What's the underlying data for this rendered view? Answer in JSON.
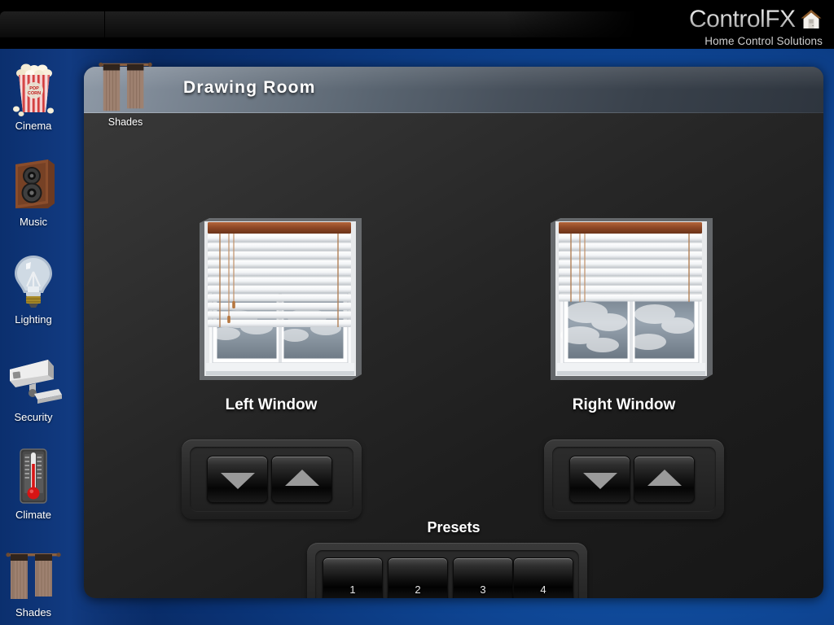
{
  "brand": {
    "name": "ControlFX",
    "tagline": "Home Control Solutions",
    "house_icon": "house-icon",
    "accent_blue": "#1358ae",
    "panel_dark": "#262626"
  },
  "sidebar": {
    "items": [
      {
        "label": "Cinema",
        "icon": "popcorn-icon"
      },
      {
        "label": "Music",
        "icon": "speaker-icon"
      },
      {
        "label": "Lighting",
        "icon": "lightbulb-icon"
      },
      {
        "label": "Security",
        "icon": "security-camera-icon"
      },
      {
        "label": "Climate",
        "icon": "thermometer-icon"
      },
      {
        "label": "Shades",
        "icon": "curtains-icon"
      }
    ]
  },
  "panel": {
    "title": "Drawing Room",
    "badge": {
      "label": "Shades",
      "icon": "curtains-icon"
    }
  },
  "windows": [
    {
      "label": "Left Window",
      "icon": "window-blinds-icon",
      "blind_coverage_percent": 72,
      "controls": {
        "down": {
          "label": "",
          "icon": "triangle-down-icon"
        },
        "up": {
          "label": "",
          "icon": "triangle-up-icon"
        }
      }
    },
    {
      "label": "Right Window",
      "icon": "window-blinds-icon",
      "blind_coverage_percent": 52,
      "controls": {
        "down": {
          "label": "",
          "icon": "triangle-down-icon"
        },
        "up": {
          "label": "",
          "icon": "triangle-up-icon"
        }
      }
    }
  ],
  "presets": {
    "title": "Presets",
    "buttons": [
      {
        "label": "1"
      },
      {
        "label": "2"
      },
      {
        "label": "3"
      },
      {
        "label": "4"
      }
    ]
  }
}
